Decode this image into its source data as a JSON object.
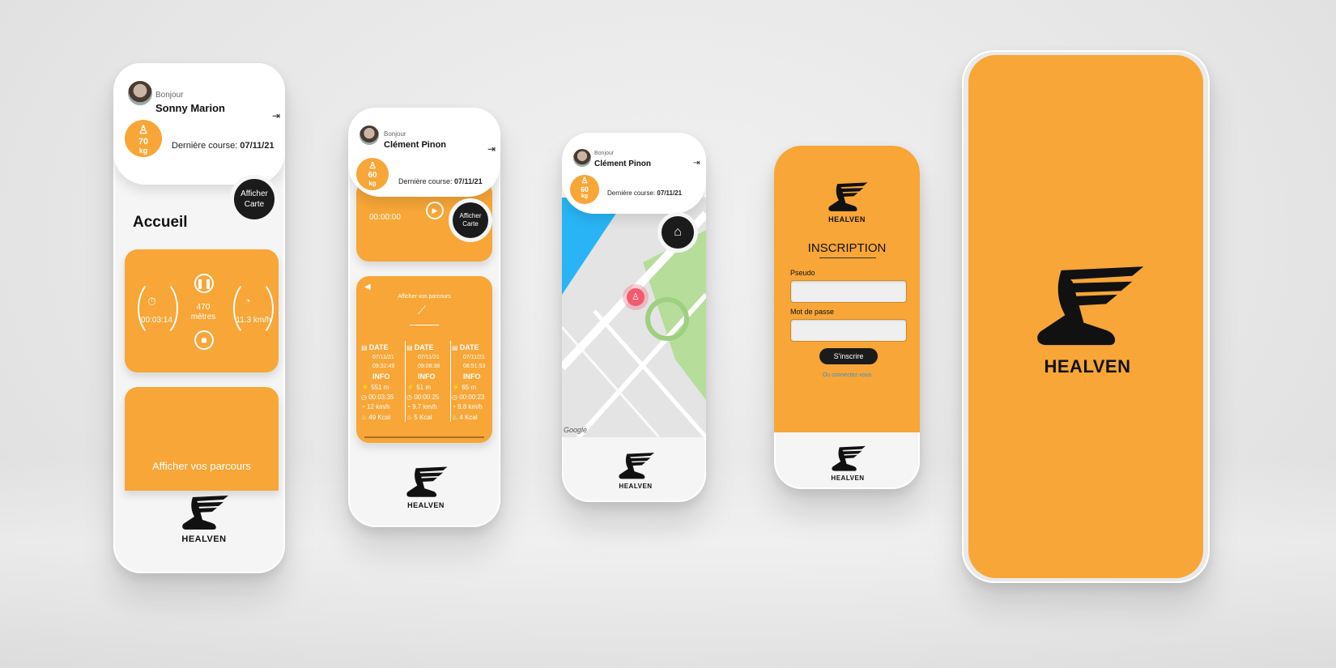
{
  "brand": {
    "name": "HEALVEN",
    "primary_color": "#f7a637",
    "dark_color": "#1b1b1b",
    "logo_icon": "winged-shoe-icon"
  },
  "screen_home": {
    "greeting": "Bonjour",
    "user_name": "Sonny Marion",
    "weight_value": "70",
    "weight_unit": "kg",
    "last_run_label": "Dernière course:",
    "last_run_date": "07/11/21",
    "map_button_line1": "Afficher",
    "map_button_line2": "Carte",
    "page_title": "Accueil",
    "timer": "00:03:14",
    "distance_value": "470",
    "distance_unit": "mètres",
    "speed": "11.3 km/h",
    "routes_button": "Afficher vos parcours"
  },
  "screen_history": {
    "greeting": "Bonjour",
    "user_name": "Clément Pinon",
    "weight_value": "60",
    "weight_unit": "kg",
    "last_run_label": "Dernière course:",
    "last_run_date": "07/11/21",
    "timer": "00:00:00",
    "map_button_line1": "Afficher",
    "map_button_line2": "Carte",
    "panel_title": "Afficher vos parcours",
    "date_header": "DATE",
    "info_header": "INFO",
    "runs": [
      {
        "date": "07/11/21",
        "time": "09:32:49",
        "distance": "551 m",
        "duration": "00:03:35",
        "speed": "12 km/h",
        "calories": "49 Kcal"
      },
      {
        "date": "07/11/21",
        "time": "09:08:38",
        "distance": "51 m",
        "duration": "00:00:25",
        "speed": "9.7 km/h",
        "calories": "5 Kcal"
      },
      {
        "date": "07/11/21",
        "time": "08:51:53",
        "distance": "65 m",
        "duration": "00:00:23",
        "speed": "9.8 km/h",
        "calories": "4 Kcal"
      }
    ]
  },
  "screen_map": {
    "greeting": "Bonjour",
    "user_name": "Clément Pinon",
    "weight_value": "60",
    "weight_unit": "kg",
    "last_run_label": "Dernière course:",
    "last_run_date": "07/11/21",
    "map_attribution": "Google"
  },
  "screen_signup": {
    "title": "INSCRIPTION",
    "pseudo_label": "Pseudo",
    "password_label": "Mot de passe",
    "submit_button": "S'inscrire",
    "login_link": "Ou connectez-vous"
  }
}
